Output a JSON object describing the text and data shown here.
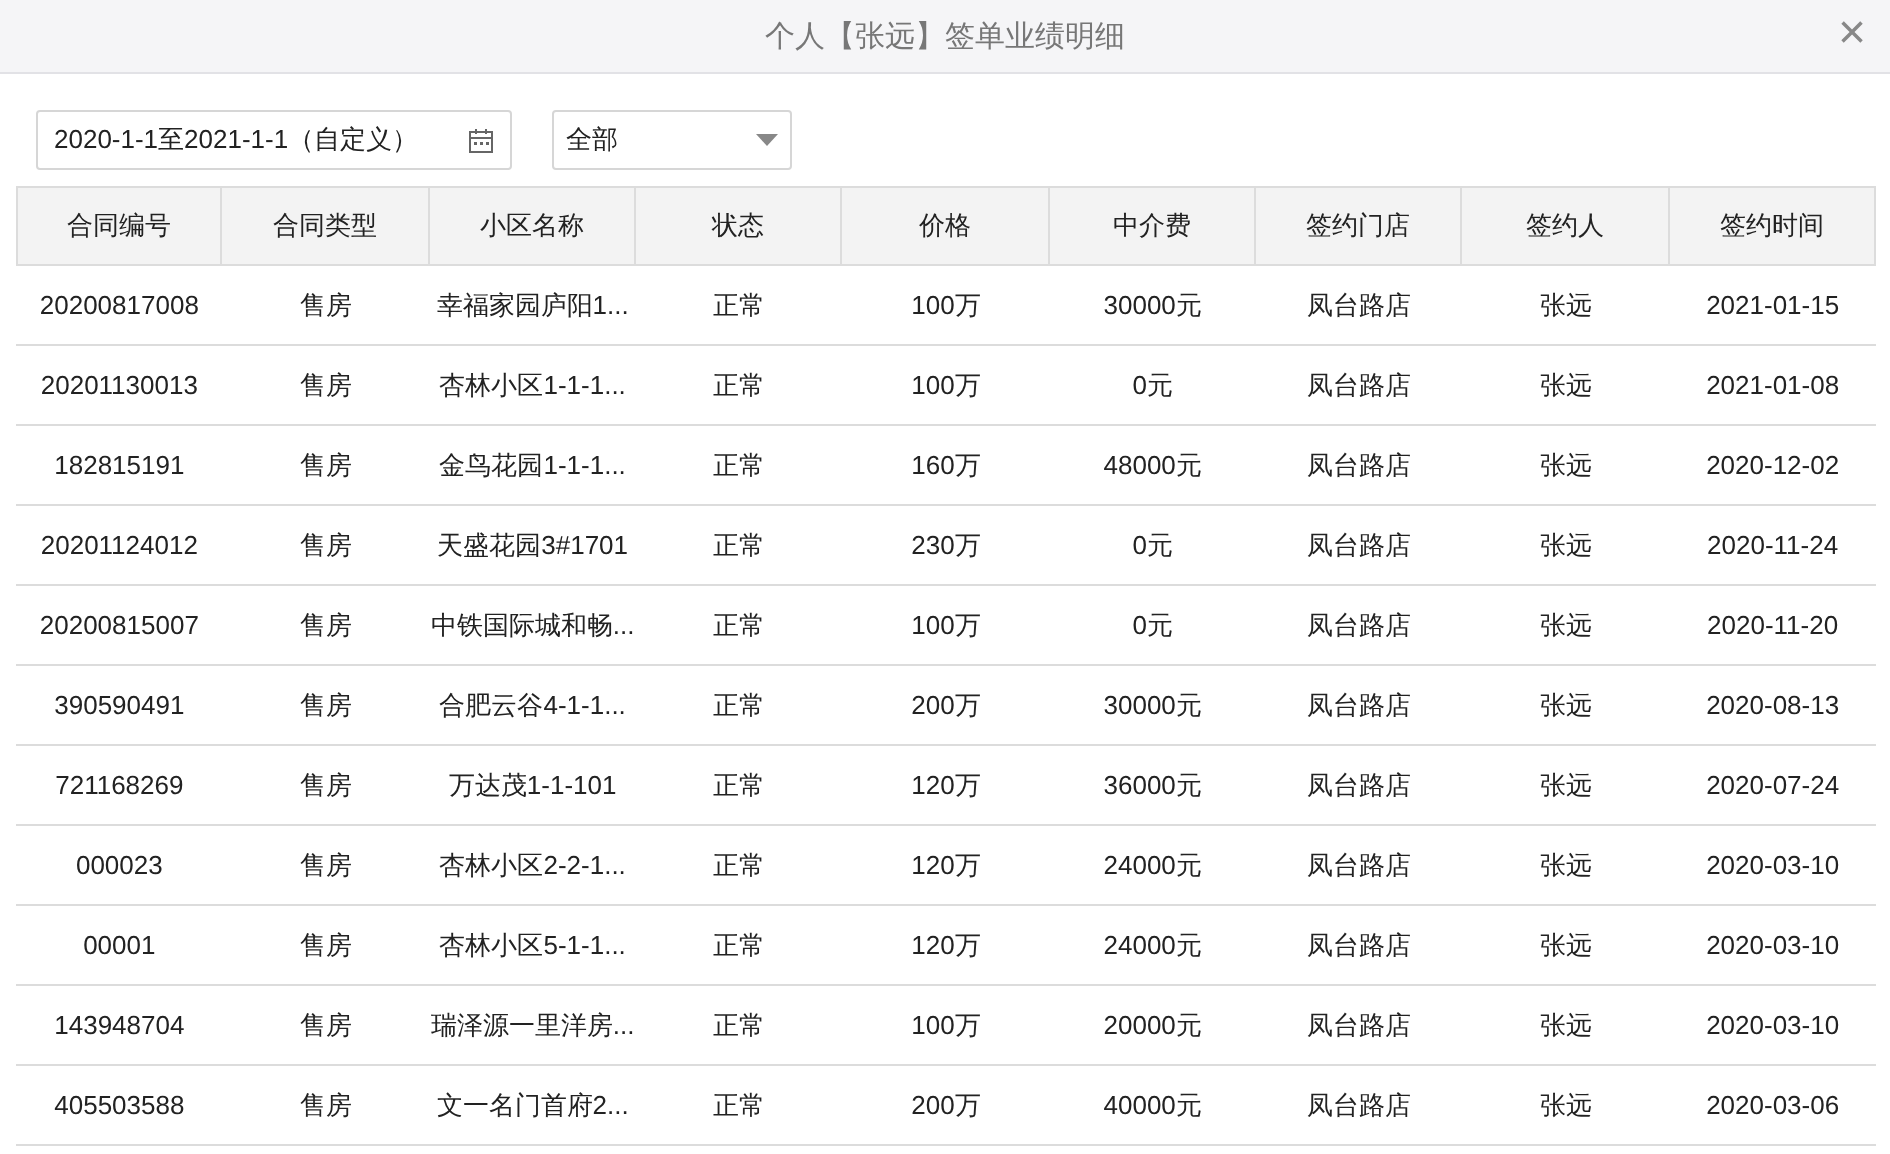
{
  "window": {
    "title": "个人【张远】签单业绩明细",
    "close": "×"
  },
  "filters": {
    "date_range": "2020-1-1至2021-1-1（自定义）",
    "type_select": "全部"
  },
  "table": {
    "columns": [
      "合同编号",
      "合同类型",
      "小区名称",
      "状态",
      "价格",
      "中介费",
      "签约门店",
      "签约人",
      "签约时间"
    ],
    "rows": [
      [
        "20200817008",
        "售房",
        "幸福家园庐阳1...",
        "正常",
        "100万",
        "30000元",
        "凤台路店",
        "张远",
        "2021-01-15"
      ],
      [
        "20201130013",
        "售房",
        "杏林小区1-1-1...",
        "正常",
        "100万",
        "0元",
        "凤台路店",
        "张远",
        "2021-01-08"
      ],
      [
        "182815191",
        "售房",
        "金鸟花园1-1-1...",
        "正常",
        "160万",
        "48000元",
        "凤台路店",
        "张远",
        "2020-12-02"
      ],
      [
        "20201124012",
        "售房",
        "天盛花园3#1701",
        "正常",
        "230万",
        "0元",
        "凤台路店",
        "张远",
        "2020-11-24"
      ],
      [
        "20200815007",
        "售房",
        "中铁国际城和畅...",
        "正常",
        "100万",
        "0元",
        "凤台路店",
        "张远",
        "2020-11-20"
      ],
      [
        "390590491",
        "售房",
        "合肥云谷4-1-1...",
        "正常",
        "200万",
        "30000元",
        "凤台路店",
        "张远",
        "2020-08-13"
      ],
      [
        "721168269",
        "售房",
        "万达茂1-1-101",
        "正常",
        "120万",
        "36000元",
        "凤台路店",
        "张远",
        "2020-07-24"
      ],
      [
        "000023",
        "售房",
        "杏林小区2-2-1...",
        "正常",
        "120万",
        "24000元",
        "凤台路店",
        "张远",
        "2020-03-10"
      ],
      [
        "00001",
        "售房",
        "杏林小区5-1-1...",
        "正常",
        "120万",
        "24000元",
        "凤台路店",
        "张远",
        "2020-03-10"
      ],
      [
        "143948704",
        "售房",
        "瑞泽源一里洋房...",
        "正常",
        "100万",
        "20000元",
        "凤台路店",
        "张远",
        "2020-03-10"
      ],
      [
        "405503588",
        "售房",
        "文一名门首府2...",
        "正常",
        "200万",
        "40000元",
        "凤台路店",
        "张远",
        "2020-03-06"
      ]
    ]
  }
}
